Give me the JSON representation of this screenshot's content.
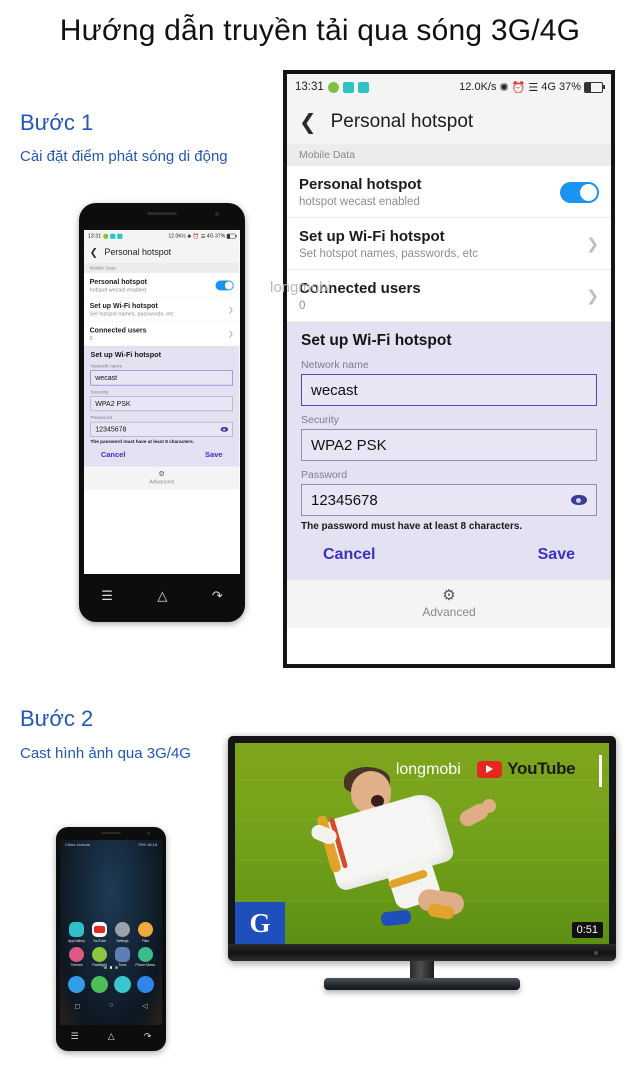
{
  "title": "Hướng dẫn truyền tải qua sóng 3G/4G",
  "steps": [
    {
      "head": "Bước 1",
      "sub": "Cài đặt điểm phát sóng di động"
    },
    {
      "head": "Bước 2",
      "sub": "Cast hình ảnh qua 3G/4G"
    }
  ],
  "watermark": "longmobi",
  "phone_screen": {
    "statusbar": {
      "time": "13:31",
      "speed": "12.0K/s",
      "bluetooth": "bluetooth-icon",
      "alarm": "alarm-icon",
      "signal": "signal-icon",
      "network": "4G",
      "battery_percent": "37%"
    },
    "appbar": {
      "back": "back-chevron-icon",
      "title": "Personal hotspot"
    },
    "section_label": "Mobile Data",
    "rows": [
      {
        "title": "Personal hotspot",
        "subtitle": "hotspot wecast enabled",
        "control": "toggle-on"
      },
      {
        "title": "Set up Wi-Fi hotspot",
        "subtitle": "Set hotspot names, passwords, etc",
        "control": "chevron"
      },
      {
        "title": "Connected users",
        "subtitle": "0",
        "control": "chevron"
      }
    ],
    "dialog": {
      "title": "Set up Wi-Fi hotspot",
      "fields": [
        {
          "label": "Network name",
          "value": "wecast",
          "focused": true
        },
        {
          "label": "Security",
          "value": "WPA2 PSK",
          "focused": false
        },
        {
          "label": "Password",
          "value": "12345678",
          "focused": false,
          "trailing_icon": "eye-icon"
        }
      ],
      "hint": "The password must have at least 8 characters.",
      "cancel": "Cancel",
      "save": "Save"
    },
    "footer": {
      "icon": "gear-icon",
      "label": "Advanced"
    }
  },
  "phone_nav": {
    "menu": "menu-icon",
    "home": "home-icon",
    "back": "back-icon"
  },
  "homescreen": {
    "carrier": "China Unicom",
    "status_right": "79%  16:16",
    "apps": [
      {
        "label": "AppGallery",
        "color": "#2fc0c8"
      },
      {
        "label": "YouTube",
        "color": "#ffffff"
      },
      {
        "label": "Settings",
        "color": "#9aa1aa"
      },
      {
        "label": "Files",
        "color": "#f0a93c"
      },
      {
        "label": "Themes",
        "color": "#e0577f"
      },
      {
        "label": "Flashlight",
        "color": "#8ec63f"
      },
      {
        "label": "Tools",
        "color": "#5d7fb5"
      },
      {
        "label": "Phone Mana.",
        "color": "#3bbd8a"
      }
    ],
    "dock": [
      {
        "label": "lock",
        "color": "#2f9fe8"
      },
      {
        "label": "phone",
        "color": "#4cbf5a"
      },
      {
        "label": "messages",
        "color": "#3bc5cf"
      },
      {
        "label": "browser",
        "color": "#2f86e8"
      }
    ],
    "page_dots": 3,
    "active_dot": 1
  },
  "tv": {
    "watermark": "longmobi",
    "youtube_label": "YouTube",
    "channel_logo": "G",
    "duration": "0:51"
  },
  "colors": {
    "accent_blue": "#2256b8",
    "toggle_on": "#1a94f0",
    "dialog_bg": "#e3e1f2",
    "dialog_action": "#3b32c0",
    "youtube_red": "#e5271f",
    "grass_green": "#7ea41c"
  }
}
